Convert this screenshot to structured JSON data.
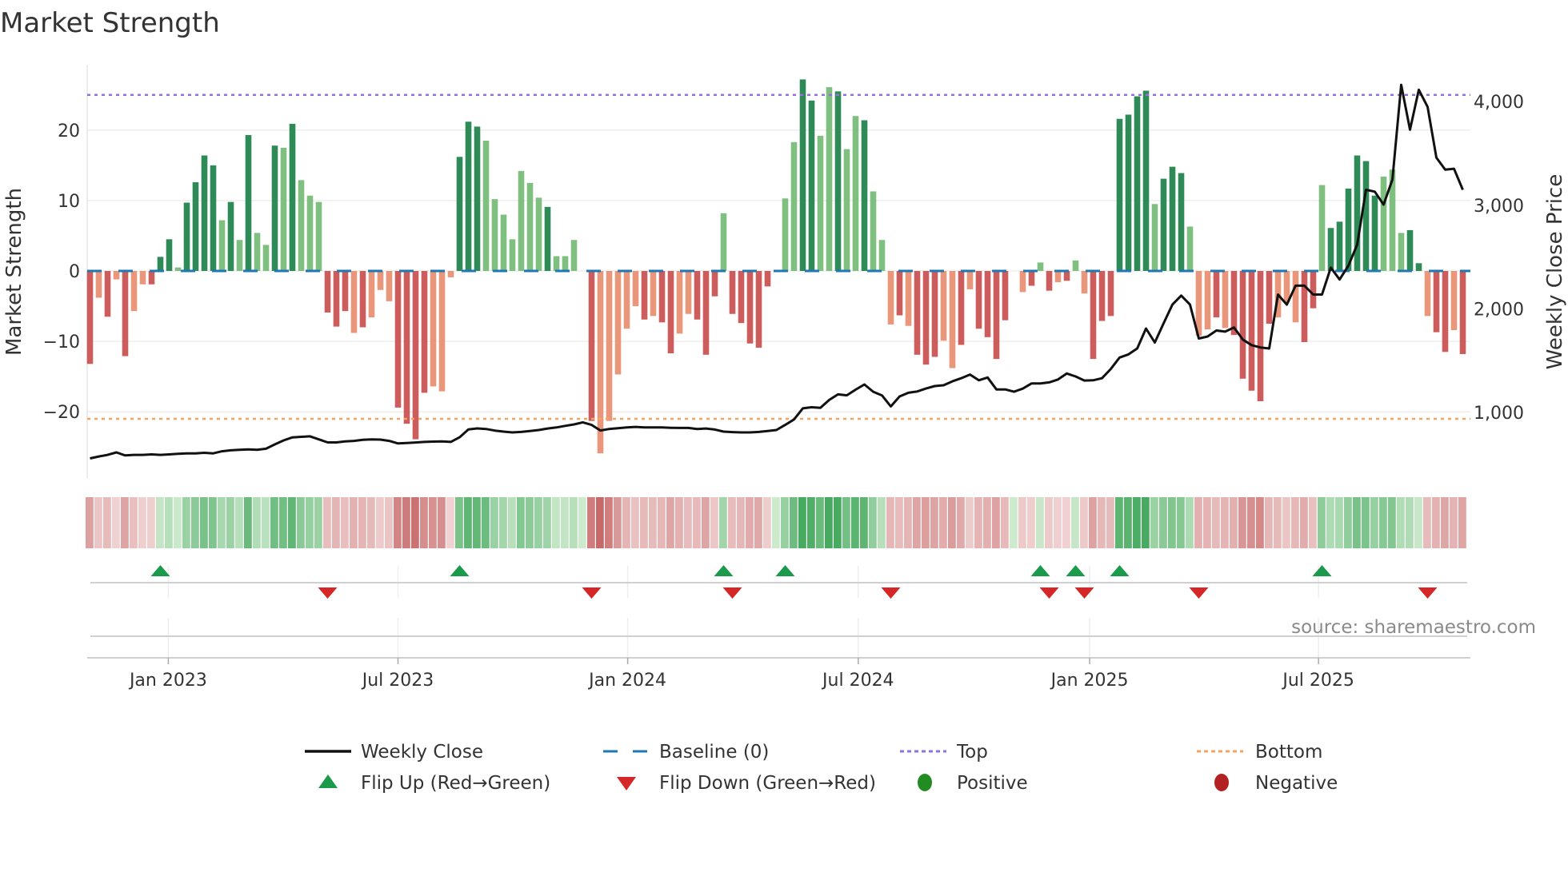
{
  "chart_data": {
    "type": "bar",
    "title": "Market Strength",
    "ylabel": "Market Strength",
    "y2label": "Weekly Close Price",
    "ylim": [
      -27.5,
      29
    ],
    "y2lim": [
      560,
      4300
    ],
    "y_ticks": [
      {
        "value": 20,
        "label": "20"
      },
      {
        "value": 10,
        "label": "10"
      },
      {
        "value": 0,
        "label": "0"
      },
      {
        "value": -10,
        "label": "−10"
      },
      {
        "value": -20,
        "label": "−20"
      }
    ],
    "y2_ticks": [
      {
        "value": 1000,
        "label": "1,000"
      },
      {
        "value": 2000,
        "label": "2,000"
      },
      {
        "value": 3000,
        "label": "3,000"
      },
      {
        "value": 4000,
        "label": "4,000"
      }
    ],
    "x_ticks": [
      {
        "label": "Jan 2023",
        "week_index": 8.9
      },
      {
        "label": "Jul 2023",
        "week_index": 35
      },
      {
        "label": "Jan 2024",
        "week_index": 61.1
      },
      {
        "label": "Jul 2024",
        "week_index": 87.3
      },
      {
        "label": "Jan 2025",
        "week_index": 113.6
      },
      {
        "label": "Jul 2025",
        "week_index": 139.6
      }
    ],
    "top_level": 25,
    "bottom_level": -21,
    "baseline": 0,
    "strength": [
      -13.2,
      -3.8,
      -6.5,
      -1.2,
      -12.1,
      -5.7,
      -1.9,
      -1.9,
      2.0,
      4.5,
      0.5,
      9.7,
      12.6,
      16.4,
      15.0,
      7.2,
      9.8,
      4.4,
      19.3,
      5.4,
      3.7,
      17.8,
      17.5,
      20.9,
      12.9,
      10.7,
      9.8,
      -5.9,
      -7.9,
      -5.7,
      -8.8,
      -8.0,
      -6.6,
      -2.7,
      -4.3,
      -19.4,
      -21.7,
      -23.9,
      -17.3,
      -16.4,
      -17.1,
      -0.9,
      16.2,
      21.2,
      20.5,
      18.5,
      10.2,
      8.0,
      4.5,
      14.2,
      12.5,
      10.4,
      9.1,
      2.1,
      2.1,
      4.4,
      0,
      -21.3,
      -25.9,
      -21.3,
      -14.7,
      -8.2,
      -5.0,
      -6.9,
      -6.4,
      -7.3,
      -11.7,
      -8.9,
      -6.1,
      -6.9,
      -11.9,
      -3.6,
      8.2,
      -6.1,
      -7.4,
      -10.3,
      -10.9,
      -2.2,
      0,
      10.3,
      18.3,
      27.2,
      24.2,
      19.2,
      26.1,
      25.5,
      17.3,
      22.0,
      21.4,
      11.3,
      4.4,
      -7.6,
      -6.3,
      -7.8,
      -11.9,
      -13.3,
      -12.2,
      -9.9,
      -13.8,
      -10.5,
      -2.6,
      -8.2,
      -9.4,
      -12.5,
      -7.0,
      0,
      -3.0,
      -2.1,
      1.2,
      -2.8,
      -1.6,
      -1.4,
      1.5,
      -3.2,
      -12.5,
      -7.1,
      -6.4,
      21.6,
      22.2,
      24.8,
      25.6,
      9.5,
      13.1,
      14.8,
      13.9,
      6.3,
      -9.2,
      -8.3,
      -6.6,
      -8.1,
      -9.1,
      -15.3,
      -17.0,
      -18.5,
      -7.5,
      -6.6,
      -4.4,
      -7.3,
      -10.1,
      -5.3,
      12.2,
      6.1,
      7.0,
      11.7,
      16.4,
      15.6,
      10.7,
      13.4,
      14.4,
      5.4,
      5.8,
      1.1,
      -6.4,
      -8.7,
      -11.5,
      -8.4,
      -11.8
    ],
    "strength_shade": "dldldlldddlddddldldlldldllldddldlllddddllldddllllllldlllddllllldlddlldddldddddlllddlldlldllldldddlldlddddlldldldlldddddddldddllldldddddlllddlddddddlllddlddldddl",
    "weekly_close": [
      556,
      575,
      590,
      614,
      585,
      590,
      590,
      595,
      590,
      595,
      600,
      605,
      605,
      610,
      605,
      625,
      634,
      640,
      643,
      640,
      650,
      691,
      730,
      759,
      765,
      769,
      740,
      711,
      711,
      720,
      725,
      735,
      740,
      738,
      725,
      701,
      705,
      710,
      715,
      718,
      720,
      715,
      760,
      836,
      846,
      840,
      825,
      815,
      807,
      812,
      820,
      830,
      845,
      855,
      870,
      884,
      904,
      880,
      826,
      840,
      848,
      855,
      860,
      855,
      855,
      855,
      852,
      850,
      850,
      840,
      845,
      835,
      815,
      810,
      807,
      807,
      812,
      820,
      830,
      880,
      932,
      1039,
      1050,
      1045,
      1120,
      1174,
      1165,
      1220,
      1270,
      1200,
      1164,
      1058,
      1154,
      1190,
      1202,
      1231,
      1255,
      1262,
      1300,
      1330,
      1366,
      1310,
      1337,
      1222,
      1222,
      1200,
      1230,
      1280,
      1280,
      1290,
      1318,
      1376,
      1347,
      1308,
      1310,
      1330,
      1420,
      1530,
      1560,
      1617,
      1810,
      1675,
      1860,
      2041,
      2128,
      2041,
      1714,
      1733,
      1791,
      1780,
      1820,
      1704,
      1650,
      1627,
      1617,
      2138,
      2041,
      2224,
      2224,
      2138,
      2138,
      2398,
      2283,
      2417,
      2620,
      3150,
      3131,
      3006,
      3247,
      4163,
      3729,
      4115,
      3950,
      3459,
      3343,
      3353,
      3150
    ],
    "flip_up_weeks": [
      8,
      42,
      72,
      79,
      108,
      112,
      117,
      140
    ],
    "flip_down_weeks": [
      27,
      57,
      73,
      91,
      109,
      113,
      126,
      152
    ],
    "legend_placement": "bottom-center",
    "grid": true,
    "source": "source: sharemaestro.com",
    "legend": [
      {
        "key": "weekly_close",
        "label": "Weekly Close"
      },
      {
        "key": "baseline",
        "label": "Baseline (0)"
      },
      {
        "key": "top",
        "label": "Top"
      },
      {
        "key": "bottom",
        "label": "Bottom"
      },
      {
        "key": "flip_up",
        "label": "Flip Up (Red→Green)"
      },
      {
        "key": "flip_down",
        "label": "Flip Down (Green→Red)"
      },
      {
        "key": "positive",
        "label": "Positive"
      },
      {
        "key": "negative",
        "label": "Negative"
      }
    ]
  },
  "colors": {
    "pos_dark": "#2e8b57",
    "pos_light": "#7fbf7f",
    "neg_dark": "#cd5c5c",
    "neg_light": "#e9967a",
    "baseline": "#1f77b4",
    "top": "#9370db",
    "bottom": "#f4a460",
    "line": "#111111",
    "flip_up": "#1a9a4a",
    "flip_down": "#d62728",
    "positive": "#228b22",
    "negative": "#b22222"
  }
}
